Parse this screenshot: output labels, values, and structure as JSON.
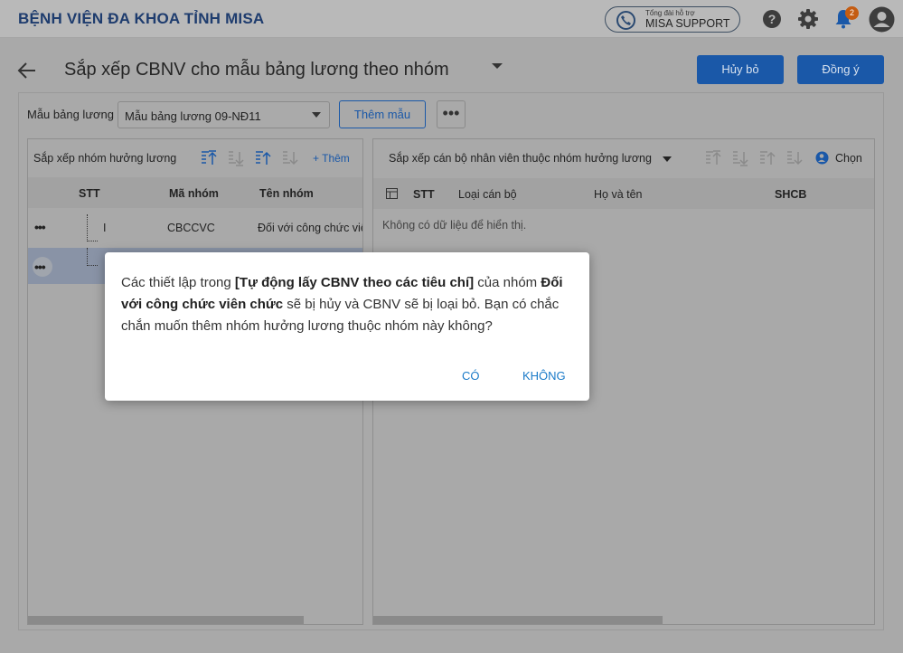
{
  "header": {
    "hospital_name": "BỆNH VIỆN ĐA KHOA TỈNH MISA",
    "support_small": "Tổng đài hỗ trợ",
    "support_label": "MISA SUPPORT",
    "notification_count": "2"
  },
  "page": {
    "title": "Sắp xếp CBNV cho mẫu bảng lương theo nhóm",
    "cancel_label": "Hủy bỏ",
    "ok_label": "Đồng ý"
  },
  "template": {
    "label": "Mẫu bảng lương",
    "selected": "Mẫu bảng lương 09-NĐ11",
    "add_label": "Thêm mẫu",
    "more_label": "•••"
  },
  "left_panel": {
    "title": "Sắp xếp nhóm hưởng lương",
    "add_label": "+ Thêm",
    "columns": [
      "STT",
      "Mã nhóm",
      "Tên nhóm"
    ],
    "rows": [
      {
        "stt": "I",
        "code": "CBCCVC",
        "name": "Đối với công chức viên chức"
      }
    ]
  },
  "right_panel": {
    "title": "Sắp xếp cán bộ nhân viên thuộc nhóm hưởng lương",
    "choose_label": "Chọn",
    "columns": [
      "STT",
      "Loại cán bộ",
      "Họ và tên",
      "SHCB"
    ],
    "empty_text": "Không có dữ liệu để hiển thị."
  },
  "dialog": {
    "msg_1": "Các thiết lập trong ",
    "msg_bold_1": "[Tự động lấy CBNV theo các tiêu chí]",
    "msg_2": " của nhóm ",
    "msg_bold_2": "Đối với công chức viên chức",
    "msg_3": " sẽ bị hủy và CBNV sẽ bị loại bỏ. Bạn có chắc chắn muốn thêm nhóm hưởng lương thuộc nhóm này không?",
    "yes_label": "CÓ",
    "no_label": "KHÔNG"
  },
  "colors": {
    "primary": "#1a58a8",
    "dialog_link": "#1a7ac8",
    "badge": "#c45c12"
  }
}
